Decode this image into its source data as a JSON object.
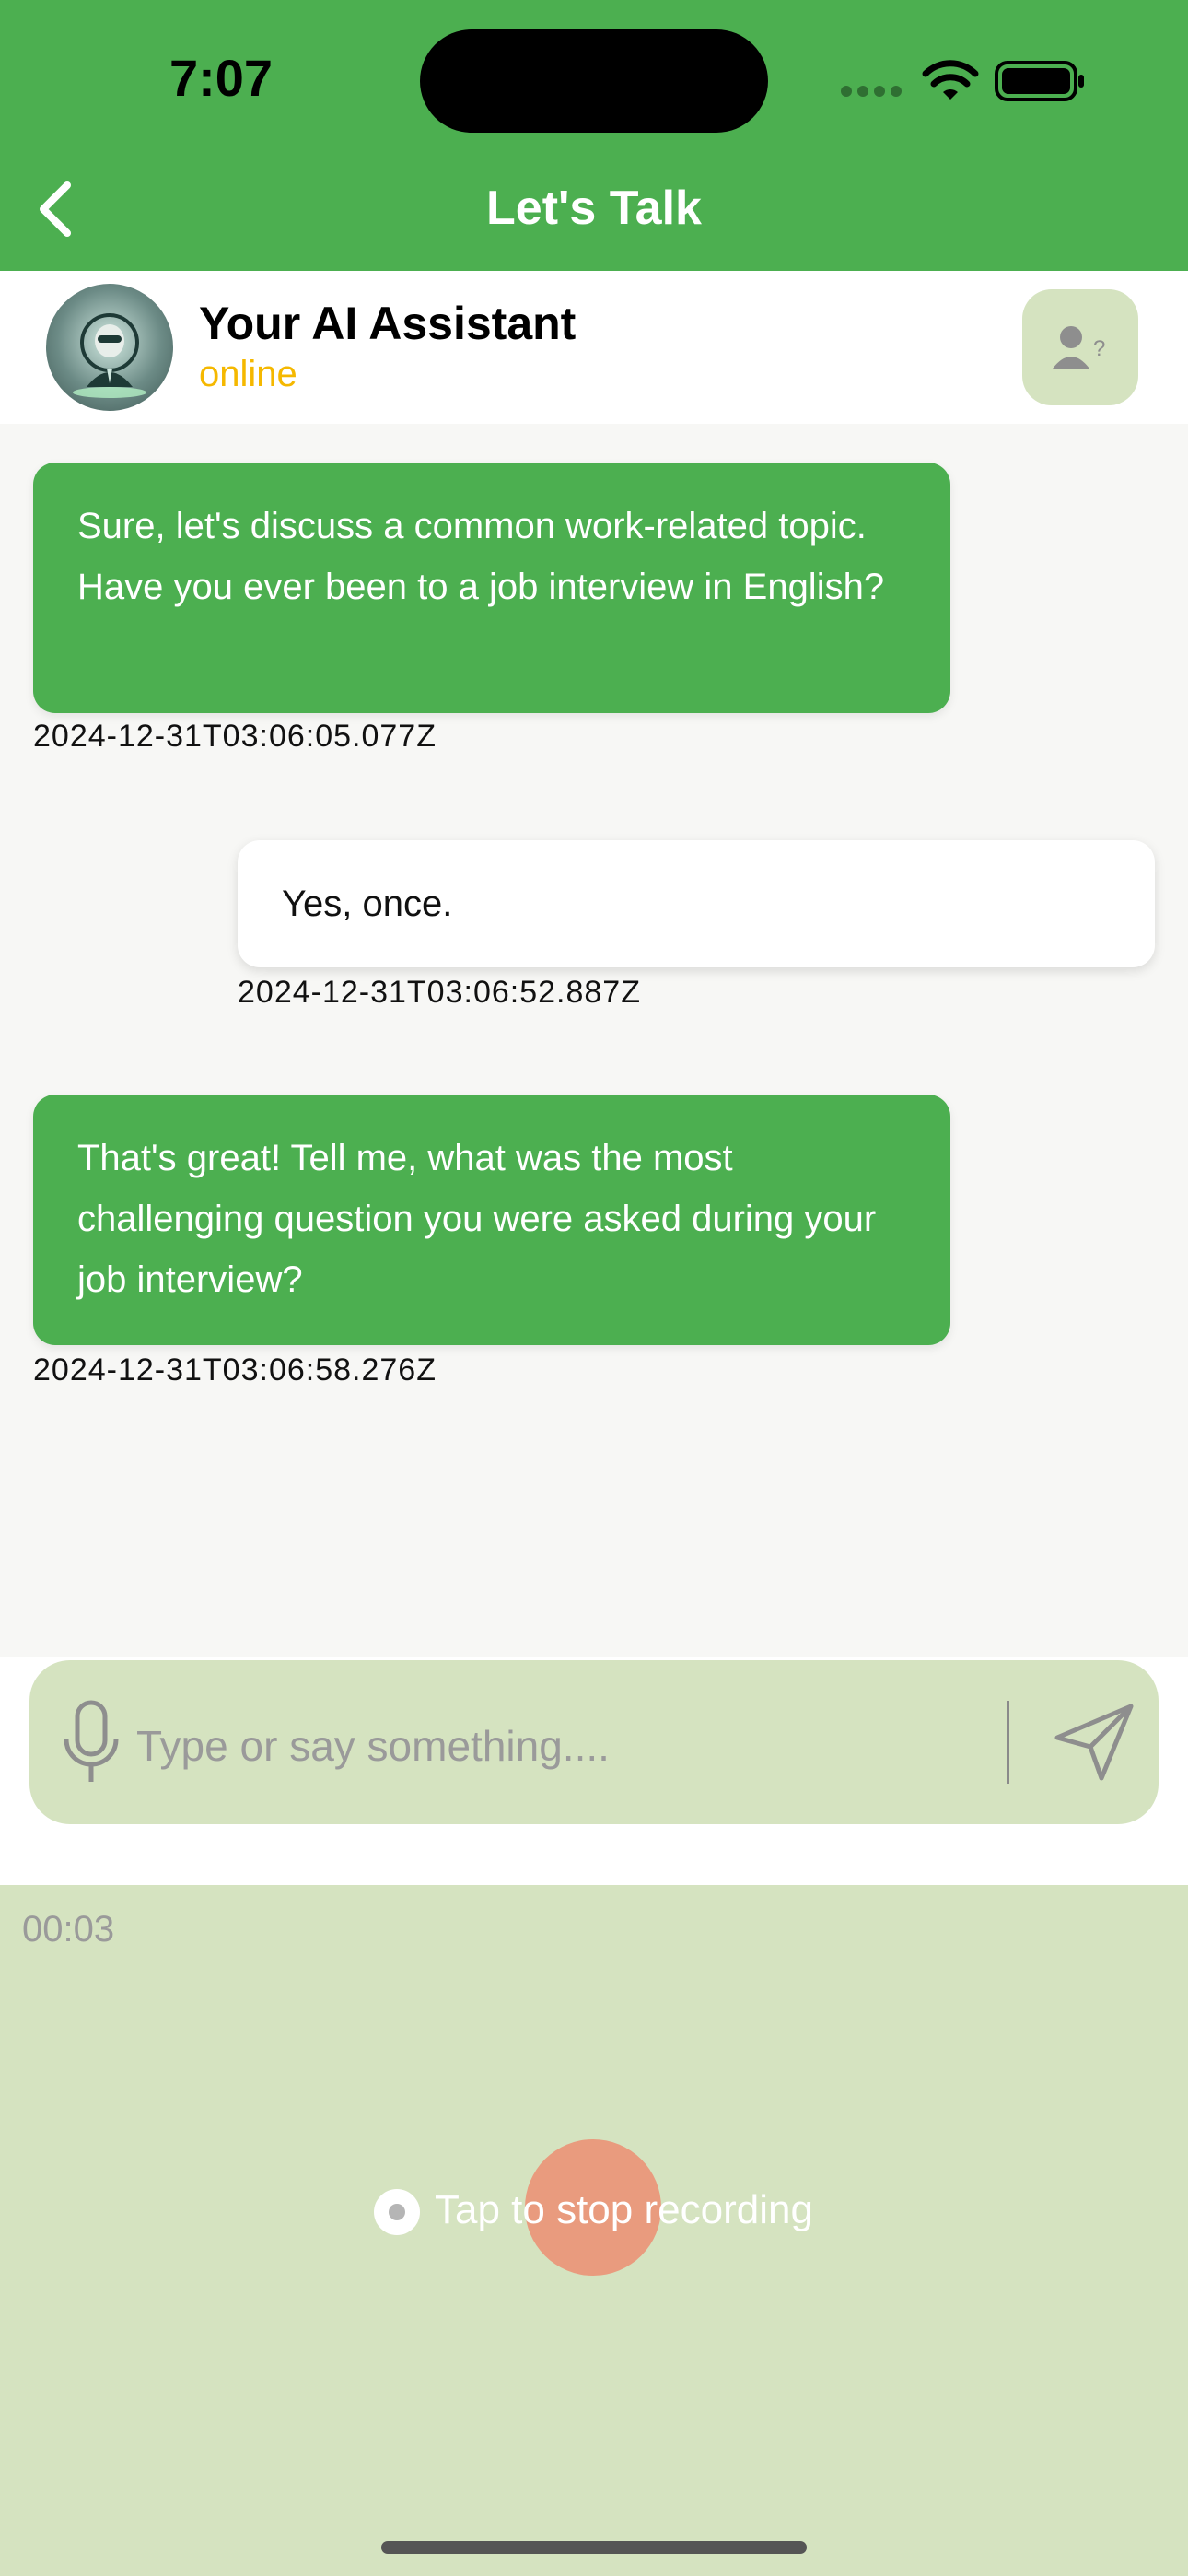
{
  "status_bar": {
    "time": "7:07"
  },
  "nav": {
    "title": "Let's Talk"
  },
  "header": {
    "name": "Your AI Assistant",
    "status": "online",
    "status_color": "#F5B800"
  },
  "messages": [
    {
      "role": "assistant",
      "text": "Sure, let's discuss a common work-related topic. Have you ever been to a job interview in English?",
      "timestamp": "2024-12-31T03:06:05.077Z"
    },
    {
      "role": "user",
      "text": "Yes, once.",
      "timestamp": "2024-12-31T03:06:52.887Z"
    },
    {
      "role": "assistant",
      "text": "That's great! Tell me, what was the most challenging question you were asked during your job interview?",
      "timestamp": "2024-12-31T03:06:58.276Z"
    }
  ],
  "composer": {
    "placeholder": "Type or say something...."
  },
  "recording": {
    "timer": "00:03",
    "stop_label": "Tap to stop recording"
  },
  "theme": {
    "accent": "#4CAF50",
    "panel": "#D5E3C0",
    "stop_button": "#E99B7E"
  },
  "icons": [
    "back-chevron-icon",
    "avatar-robot",
    "profile-question-icon",
    "microphone-icon",
    "send-icon",
    "record-dot-icon",
    "wifi-icon",
    "battery-icon"
  ]
}
